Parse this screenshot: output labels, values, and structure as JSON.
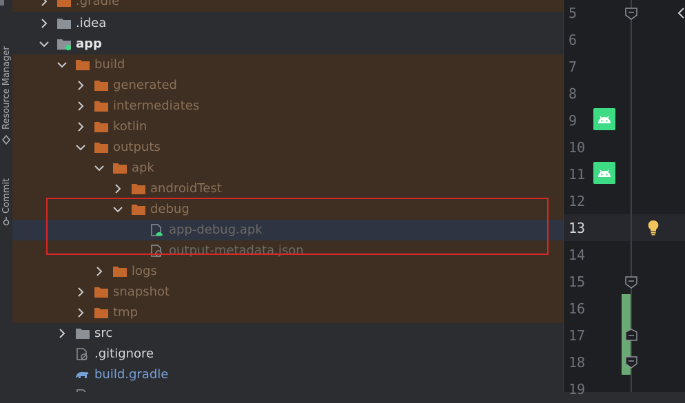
{
  "tool_strip": {
    "resource_manager": "Resource Manager",
    "commit": "Commit"
  },
  "tree": {
    "rows": [
      {
        "label": ".gradle"
      },
      {
        "label": ".idea"
      },
      {
        "label": "app"
      },
      {
        "label": "build"
      },
      {
        "label": "generated"
      },
      {
        "label": "intermediates"
      },
      {
        "label": "kotlin"
      },
      {
        "label": "outputs"
      },
      {
        "label": "apk"
      },
      {
        "label": "androidTest"
      },
      {
        "label": "debug"
      },
      {
        "label": "app-debug.apk"
      },
      {
        "label": "output-metadata.json"
      },
      {
        "label": "logs"
      },
      {
        "label": "snapshot"
      },
      {
        "label": "tmp"
      },
      {
        "label": "src"
      },
      {
        "label": ".gitignore"
      },
      {
        "label": "build.gradle"
      }
    ]
  },
  "gutter": {
    "line_numbers": [
      "5",
      "6",
      "7",
      "8",
      "9",
      "10",
      "11",
      "12",
      "13",
      "14",
      "15",
      "16",
      "17",
      "18",
      "19"
    ],
    "current_line": "13"
  },
  "colors": {
    "excluded_bg": "#3e2f22",
    "folder": "#c4672c",
    "android": "#3ddc84",
    "highlight_border": "#d62828"
  }
}
